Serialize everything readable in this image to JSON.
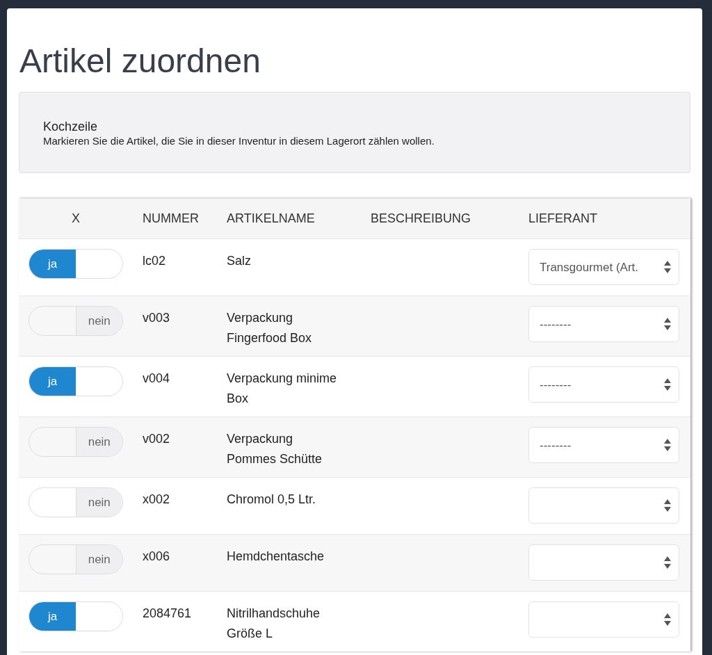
{
  "title": "Artikel zuordnen",
  "info": {
    "heading": "Kochzeile",
    "text": "Markieren Sie die Artikel, die Sie in dieser Inventur in diesem Lagerort zählen wollen."
  },
  "table": {
    "columns": [
      "X",
      "NUMMER",
      "ARTIKELNAME",
      "BESCHREIBUNG",
      "LIEFERANT"
    ],
    "rows": [
      {
        "toggle": {
          "on": true,
          "label": "ja"
        },
        "nummer": "lc02",
        "artikelname": "Salz",
        "lieferant": "Transgourmet (Art."
      },
      {
        "toggle": {
          "on": false,
          "label": "nein"
        },
        "nummer": "v003",
        "artikelname": "Verpackung Fingerfood Box",
        "lieferant": "--------"
      },
      {
        "toggle": {
          "on": true,
          "label": "ja"
        },
        "nummer": "v004",
        "artikelname": "Verpackung minime Box",
        "lieferant": "--------"
      },
      {
        "toggle": {
          "on": false,
          "label": "nein"
        },
        "nummer": "v002",
        "artikelname": "Verpackung Pommes Schütte",
        "lieferant": "--------"
      },
      {
        "toggle": {
          "on": false,
          "label": "nein"
        },
        "nummer": "x002",
        "artikelname": "Chromol 0,5 Ltr."
      },
      {
        "toggle": {
          "on": false,
          "label": "nein"
        },
        "nummer": "x006",
        "artikelname": "Hemdchentasche"
      },
      {
        "toggle": {
          "on": true,
          "label": "ja"
        },
        "nummer": "2084761",
        "artikelname": "Nitrilhandschuhe Größe L"
      }
    ]
  }
}
